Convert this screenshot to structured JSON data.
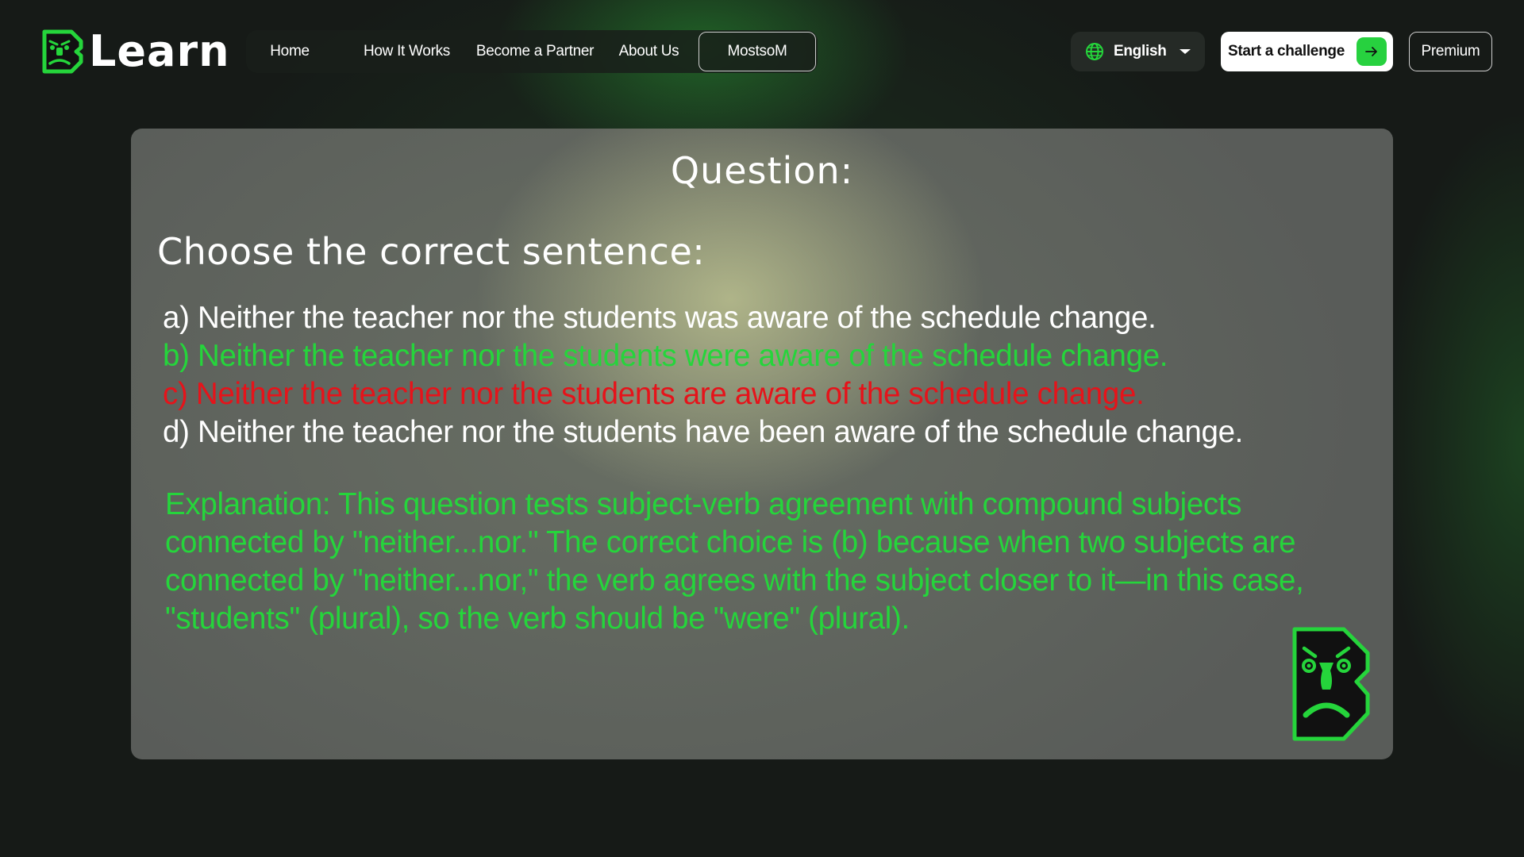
{
  "header": {
    "logo_text": "Learn",
    "logo_icon": "angry-face-b-logo-icon",
    "nav": [
      {
        "label": "Home"
      },
      {
        "label": "How It Works"
      },
      {
        "label": "Become a Partner"
      },
      {
        "label": "About Us"
      }
    ],
    "user_label": "MostsoM",
    "language": {
      "label": "English",
      "icon": "globe-icon"
    },
    "cta": {
      "label": "Start a challenge",
      "icon": "arrow-right-icon"
    },
    "premium_label": "Premium"
  },
  "quiz": {
    "title": "Question:",
    "prompt": "Choose the correct sentence:",
    "options": [
      {
        "text": "a) Neither the teacher nor the students was aware of the schedule change.",
        "state": "neutral"
      },
      {
        "text": "b) Neither the teacher nor the students were aware of the schedule change.",
        "state": "correct"
      },
      {
        "text": "c) Neither the teacher nor the students are aware of the schedule change.",
        "state": "wrong"
      },
      {
        "text": "d) Neither the teacher nor the students have been aware of the schedule change.",
        "state": "neutral"
      }
    ],
    "explanation": "Explanation: This question tests subject-verb agreement with compound subjects connected by \"neither...nor.\" The correct choice is (b) because when two subjects are connected by \"neither...nor,\" the verb agrees with the subject closer to it—in this case, \"students\" (plural), so the verb should be \"were\" (plural).",
    "mascot_icon": "angry-face-b-mascot-icon"
  },
  "colors": {
    "accent_green": "#25d53b",
    "wrong_red": "#e6131a",
    "card_bg": "#595c59",
    "page_bg": "#161a17"
  }
}
